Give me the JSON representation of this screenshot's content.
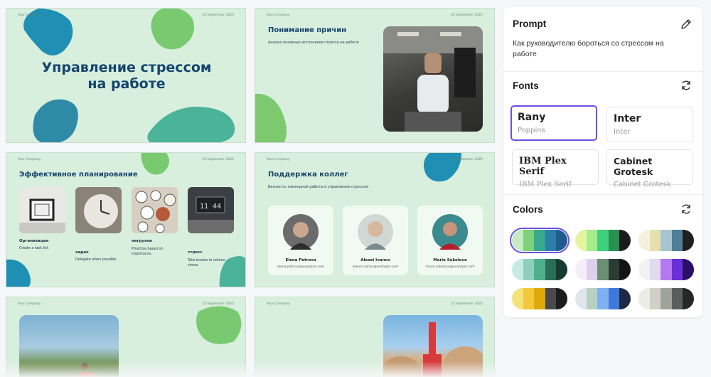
{
  "slides": {
    "company": "Your Company",
    "date": "22 September 2025",
    "s1": {
      "title": "Управление стрессом на работе"
    },
    "s2": {
      "title": "Понимание причин",
      "subtitle": "Анализ основных источников стресса на работе"
    },
    "s3": {
      "title": "Эффективное планирование",
      "items": [
        {
          "label": "Организация",
          "desc": "Create a task list."
        },
        {
          "label": "задач",
          "desc": "Delegate when possible."
        },
        {
          "label": "нагрузки",
          "desc": "Prioritize based on importance."
        },
        {
          "label": "стресс",
          "desc": "Take breaks to relieve stress."
        }
      ]
    },
    "s4": {
      "title": "Поддержка коллег",
      "subtitle": "Важность командной работы в управлении стрессом",
      "people": [
        {
          "name": "Elena Petrova",
          "email": "elena.petrova@example.com"
        },
        {
          "name": "Alexei Ivanov",
          "email": "alexei.ivanov@example.com"
        },
        {
          "name": "Maria Sokolova",
          "email": "maria.sokolova@example.com"
        }
      ]
    }
  },
  "panel": {
    "prompt_heading": "Prompt",
    "prompt_text": "Как руководителю бороться со стрессом на работе",
    "fonts_heading": "Fonts",
    "fonts": [
      {
        "name": "Rany",
        "sub": "Poppins"
      },
      {
        "name": "Inter",
        "sub": "Inter"
      },
      {
        "name": "IBM Plex Serif",
        "sub": "IBM Plex Serif"
      },
      {
        "name": "Cabinet Grotesk",
        "sub": "Cabinet Grotesk"
      }
    ],
    "colors_heading": "Colors",
    "selected_font_index": 0,
    "selected_palette_index": 0,
    "palettes": [
      [
        "#c4ecc0",
        "#7ed17a",
        "#39a88e",
        "#2b7fa8",
        "#1f5b8c"
      ],
      [
        "#e4f5a0",
        "#a6ec8c",
        "#3ed07a",
        "#2a8f52",
        "#1a1d1c"
      ],
      [
        "#f4f1dc",
        "#e7dfb0",
        "#a8c4d0",
        "#4f7f99",
        "#1f1f22"
      ],
      [
        "#c7ebe0",
        "#8fd0bd",
        "#4fb08e",
        "#2a6f55",
        "#173b30"
      ],
      [
        "#f4eef8",
        "#dcd0ee",
        "#6a8f72",
        "#2b3d33",
        "#141615"
      ],
      [
        "#f2f2f2",
        "#e3d9f0",
        "#b47bf0",
        "#6b2fd6",
        "#2a0f66"
      ],
      [
        "#f7e27a",
        "#f1c93a",
        "#e0a90a",
        "#4a4a4a",
        "#1c1c1c"
      ],
      [
        "#dfe5ec",
        "#b8d0c0",
        "#7eb0f2",
        "#3e78d8",
        "#1d2a44"
      ],
      [
        "#ecece7",
        "#d0d0c6",
        "#9ea39b",
        "#5a5f5a",
        "#262827"
      ]
    ]
  }
}
